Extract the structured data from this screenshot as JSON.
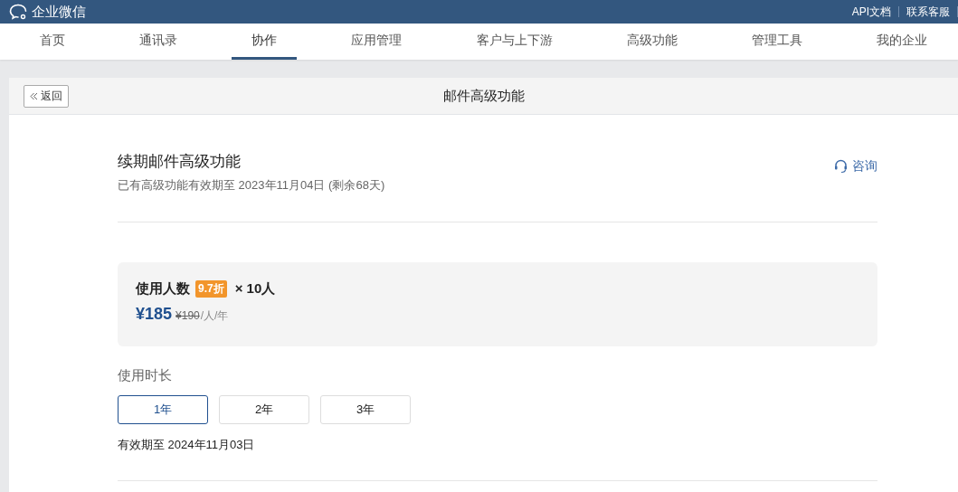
{
  "header": {
    "brand": "企业微信",
    "links": [
      "API文档",
      "联系客服"
    ]
  },
  "nav": [
    {
      "label": "首页",
      "selected": false
    },
    {
      "label": "通讯录",
      "selected": false
    },
    {
      "label": "协作",
      "selected": true
    },
    {
      "label": "应用管理",
      "selected": false
    },
    {
      "label": "客户与上下游",
      "selected": false
    },
    {
      "label": "高级功能",
      "selected": false
    },
    {
      "label": "管理工具",
      "selected": false
    },
    {
      "label": "我的企业",
      "selected": false
    }
  ],
  "page": {
    "back": "返回",
    "title": "邮件高级功能"
  },
  "renew": {
    "title": "续期邮件高级功能",
    "subtitle": "已有高级功能有效期至 2023年11月04日 (剩余68天)",
    "consult": "咨询"
  },
  "pricing": {
    "label": "使用人数",
    "discount": "9.7折",
    "count": "× 10人",
    "price": "¥185",
    "original_price": "¥190",
    "unit": "/人/年"
  },
  "duration": {
    "label": "使用时长",
    "options": [
      {
        "label": "1年",
        "selected": true
      },
      {
        "label": "2年",
        "selected": false
      },
      {
        "label": "3年",
        "selected": false
      }
    ],
    "expiry": "有效期至 2024年11月03日"
  }
}
